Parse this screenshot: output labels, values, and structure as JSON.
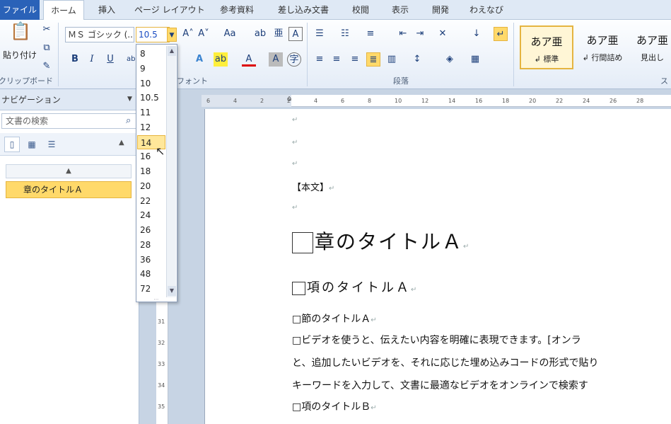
{
  "ribbon_tabs": [
    "ファイル",
    "ホーム",
    "挿入",
    "ページ レイアウト",
    "参考資料",
    "差し込み文書",
    "校閲",
    "表示",
    "開発",
    "わえなび"
  ],
  "clipboard": {
    "paste_label": "貼り付け",
    "group_label": "クリップボード"
  },
  "font": {
    "name": "ＭＳ ゴシック (...",
    "size": "10.5",
    "group_label": "フォント"
  },
  "paragraph": {
    "group_label": "段落"
  },
  "styles": [
    {
      "sample": "あア亜",
      "name": "↲ 標準"
    },
    {
      "sample": "あア亜",
      "name": "↲ 行間詰め"
    },
    {
      "sample": "あア亜",
      "name": "見出し"
    }
  ],
  "styles_group_label": "ス",
  "font_size_options": [
    "8",
    "9",
    "10",
    "10.5",
    "11",
    "12",
    "14",
    "16",
    "18",
    "20",
    "22",
    "24",
    "26",
    "28",
    "36",
    "48",
    "72"
  ],
  "font_size_hover": "14",
  "navigation": {
    "title": "ナビゲーション",
    "search_placeholder": "文書の検索",
    "collapse_symbol": "▲",
    "headings": [
      "章のタイトルＡ"
    ]
  },
  "ruler": {
    "h_labels": [
      "6",
      "4",
      "2",
      "2",
      "4",
      "6",
      "8",
      "10",
      "12",
      "14",
      "16",
      "18",
      "20",
      "22",
      "24",
      "26",
      "28"
    ],
    "v_labels": [
      "31",
      "32",
      "33",
      "34",
      "35"
    ]
  },
  "document": {
    "body_tag": "【本文】",
    "chapter_title": "章のタイトルＡ",
    "section_title": "項のタイトルＡ",
    "subsection_title": "□節のタイトルＡ",
    "body_lines": [
      "□ビデオを使うと、伝えたい内容を明確に表現できます。[オンラ",
      "と、追加したいビデオを、それに応じた埋め込みコードの形式で貼り",
      "キーワードを入力して、文書に最適なビデオをオンラインで検索す"
    ],
    "section_b": "□項のタイトルＢ",
    "para_mark": "↵"
  },
  "colors": {
    "file_tab": "#2a62b8",
    "highlight": "#ffd96a",
    "ribbon": "#dfe9f5"
  }
}
